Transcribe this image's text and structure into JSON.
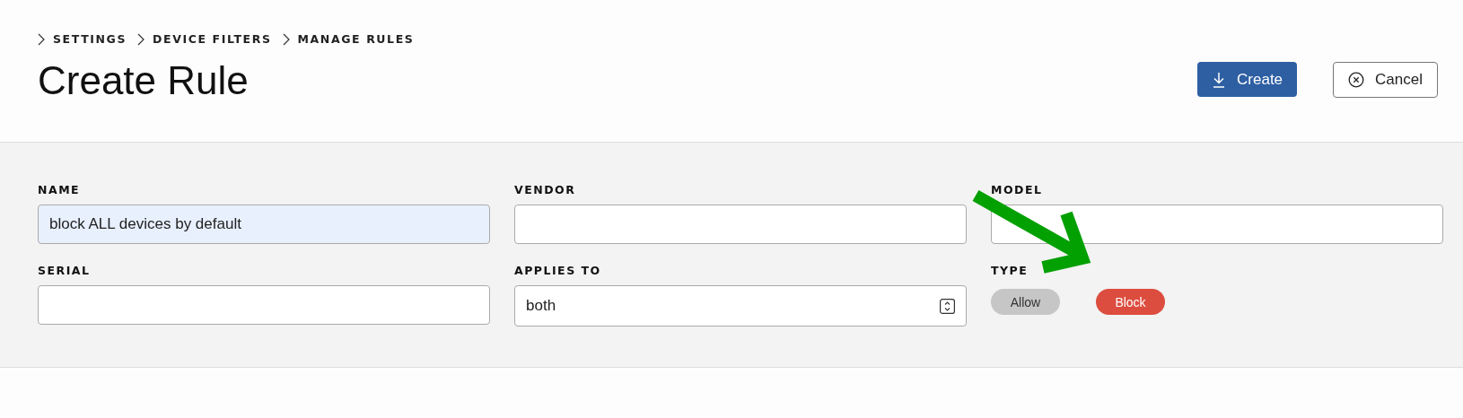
{
  "breadcrumbs": [
    "SETTINGS",
    "DEVICE FILTERS",
    "MANAGE RULES"
  ],
  "title": "Create Rule",
  "actions": [
    {
      "kind": "primary",
      "label": "Create"
    },
    {
      "kind": "secondary",
      "label": "Cancel"
    }
  ],
  "fields": [
    {
      "kind": "text",
      "label": "NAME",
      "value": "block ALL devices by default",
      "highlighted": true
    },
    {
      "kind": "text",
      "label": "VENDOR",
      "highlighted": false
    },
    {
      "kind": "text",
      "label": "MODEL",
      "highlighted": false
    },
    {
      "kind": "text",
      "label": "SERIAL",
      "highlighted": false
    },
    {
      "kind": "select",
      "label": "APPLIES TO",
      "value": "both",
      "highlighted": false
    },
    {
      "kind": "choice",
      "label": "TYPE",
      "options": [
        {
          "label": "Allow",
          "selected": false
        },
        {
          "label": "Block",
          "selected": true
        }
      ]
    }
  ]
}
